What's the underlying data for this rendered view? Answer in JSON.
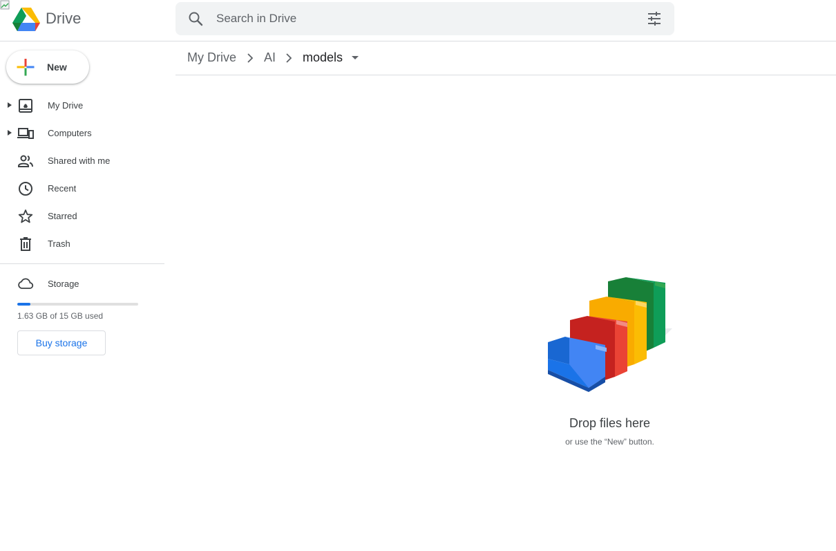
{
  "header": {
    "app_name": "Drive",
    "search_placeholder": "Search in Drive"
  },
  "sidebar": {
    "new_label": "New",
    "items": [
      {
        "label": "My Drive",
        "icon": "my-drive-icon",
        "expandable": true
      },
      {
        "label": "Computers",
        "icon": "computers-icon",
        "expandable": true
      },
      {
        "label": "Shared with me",
        "icon": "shared-icon",
        "expandable": false
      },
      {
        "label": "Recent",
        "icon": "clock-icon",
        "expandable": false
      },
      {
        "label": "Starred",
        "icon": "star-icon",
        "expandable": false
      },
      {
        "label": "Trash",
        "icon": "trash-icon",
        "expandable": false
      }
    ],
    "storage": {
      "label": "Storage",
      "used_text": "1.63 GB of 15 GB used",
      "used_fraction": 0.109,
      "buy_label": "Buy storage"
    }
  },
  "breadcrumb": [
    "My Drive",
    "AI",
    "models"
  ],
  "empty_state": {
    "title": "Drop files here",
    "subtitle": "or use the “New” button."
  },
  "colors": {
    "accent": "#1a73e8",
    "drive_green": "#0f9d58",
    "drive_yellow": "#fbbc04",
    "drive_blue": "#4285f4",
    "drive_red": "#ea4335"
  }
}
